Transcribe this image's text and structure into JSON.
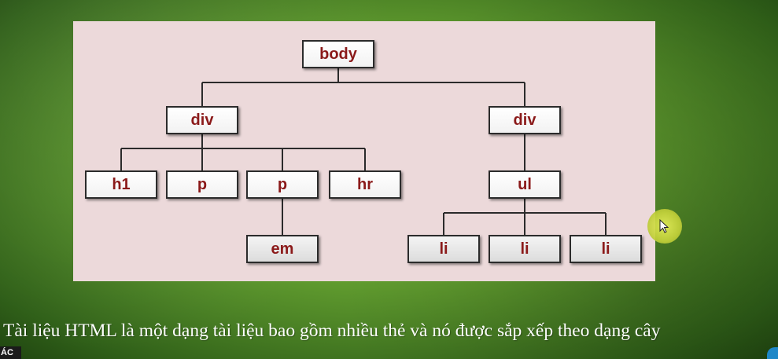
{
  "diagram": {
    "nodes": {
      "body": "body",
      "div_left": "div",
      "div_right": "div",
      "h1": "h1",
      "p1": "p",
      "p2": "p",
      "hr": "hr",
      "ul": "ul",
      "em": "em",
      "li1": "li",
      "li2": "li",
      "li3": "li"
    }
  },
  "caption": "Tài liệu HTML là một dạng tài liệu bao gồm nhiều thẻ và nó được sắp xếp theo dạng cây",
  "corner_label": "ÁC",
  "colors": {
    "panel": "#ecd9da",
    "node_text": "#8b1a1a",
    "node_border": "#2b2b2b"
  }
}
